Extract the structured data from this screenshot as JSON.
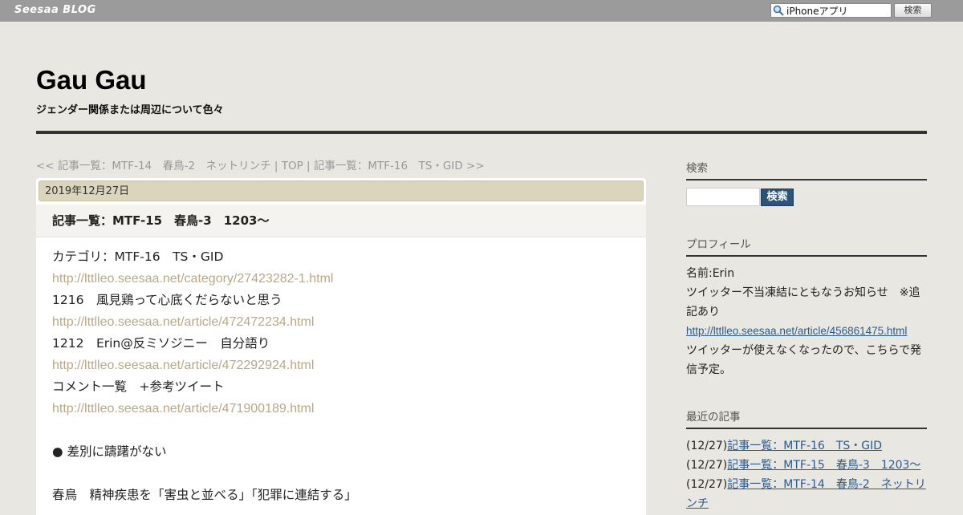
{
  "topbar": {
    "logo": "Seesaa BLOG",
    "search_value": "iPhoneアプリ",
    "search_button": "検索"
  },
  "header": {
    "title": "Gau Gau",
    "description": "ジェンダー関係または周辺について色々"
  },
  "article_nav": {
    "prev": "<< 記事一覧：MTF-14　春鳥-2　ネットリンチ",
    "sep1": " | ",
    "top": "TOP",
    "sep2": " | ",
    "next": "記事一覧：MTF-16　TS・GID >>"
  },
  "entry": {
    "date": "2019年12月27日",
    "title": "記事一覧：MTF-15　春鳥-3　1203～",
    "lines": [
      {
        "text": "カテゴリ：MTF-16　TS・GID"
      },
      {
        "link": "http://lttlleo.seesaa.net/category/27423282-1.html"
      },
      {
        "text": "1216　風見鶏って心底くだらないと思う"
      },
      {
        "link": "http://lttlleo.seesaa.net/article/472472234.html"
      },
      {
        "text": "1212　Erin@反ミソジニー　自分語り"
      },
      {
        "link": "http://lttlleo.seesaa.net/article/472292924.html"
      },
      {
        "text": "コメント一覧　+参考ツイート"
      },
      {
        "link": "http://lttlleo.seesaa.net/article/471900189.html"
      },
      {
        "text": ""
      },
      {
        "text": "● 差別に躊躇がない"
      },
      {
        "text": ""
      },
      {
        "text": "春鳥　精神疾患を「害虫と並べる」「犯罪に連結する」"
      }
    ]
  },
  "sidebar": {
    "search_heading": "検索",
    "search_button": "検索",
    "profile_heading": "プロフィール",
    "profile_name": "名前:Erin",
    "profile_notice": "ツイッター不当凍結にともなうお知らせ　※追記あり",
    "profile_link": "http://lttlleo.seesaa.net/article/456861475.html",
    "profile_note": "ツイッターが使えなくなったので、こちらで発信予定。",
    "recent_heading": "最近の記事",
    "recent": [
      {
        "date": "(12/27)",
        "title": "記事一覧：MTF-16　TS・GID"
      },
      {
        "date": "(12/27)",
        "title": "記事一覧：MTF-15　春鳥-3　1203～"
      },
      {
        "date": "(12/27)",
        "title": "記事一覧：MTF-14　春鳥-2　ネットリンチ"
      }
    ]
  }
}
